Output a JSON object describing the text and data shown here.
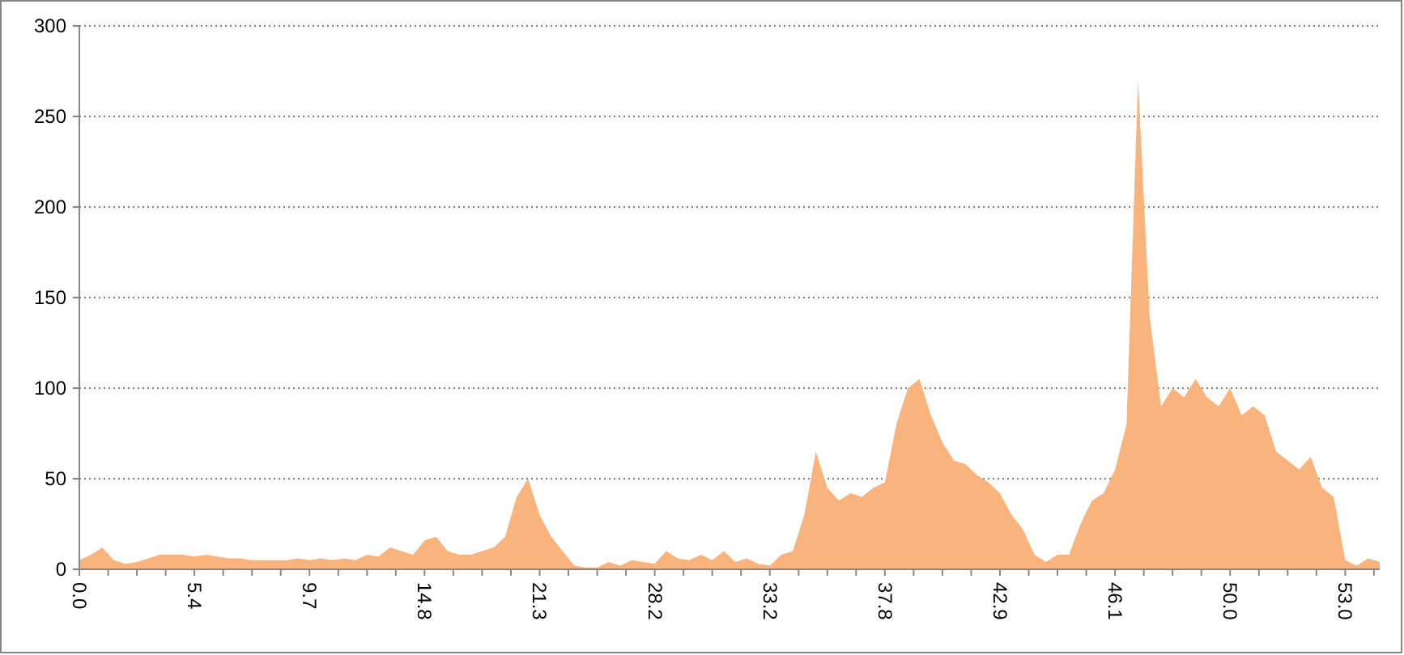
{
  "chart": {
    "chart_data": {
      "type": "area",
      "categories": [
        "0.0",
        null,
        null,
        null,
        null,
        null,
        null,
        null,
        null,
        null,
        "5.4",
        null,
        null,
        null,
        null,
        null,
        null,
        null,
        null,
        null,
        "9.7",
        null,
        null,
        null,
        null,
        null,
        null,
        null,
        null,
        null,
        "14.8",
        null,
        null,
        null,
        null,
        null,
        null,
        null,
        null,
        null,
        "21.3",
        null,
        null,
        null,
        null,
        null,
        null,
        null,
        null,
        null,
        "28.2",
        null,
        null,
        null,
        null,
        null,
        null,
        null,
        null,
        null,
        "33.2",
        null,
        null,
        null,
        null,
        null,
        null,
        null,
        null,
        null,
        "37.8",
        null,
        null,
        null,
        null,
        null,
        null,
        null,
        null,
        null,
        "42.9",
        null,
        null,
        null,
        null,
        null,
        null,
        null,
        null,
        null,
        "46.1",
        null,
        null,
        null,
        null,
        null,
        null,
        null,
        null,
        null,
        "50.0",
        null,
        null,
        null,
        null,
        null,
        null,
        null,
        null,
        null,
        "53.0",
        null,
        null,
        null
      ],
      "series": [
        {
          "color": "#f9b47d",
          "values": [
            5,
            8,
            12,
            5,
            3,
            4,
            6,
            8,
            8,
            8,
            7,
            8,
            7,
            6,
            6,
            5,
            5,
            5,
            5,
            6,
            5,
            6,
            5,
            6,
            5,
            8,
            7,
            12,
            10,
            8,
            16,
            18,
            10,
            8,
            8,
            10,
            12,
            18,
            40,
            50,
            30,
            18,
            10,
            2,
            1,
            1,
            4,
            2,
            5,
            4,
            3,
            10,
            6,
            5,
            8,
            5,
            10,
            4,
            6,
            3,
            2,
            8,
            10,
            30,
            65,
            45,
            38,
            42,
            40,
            45,
            48,
            80,
            100,
            105,
            85,
            70,
            60,
            58,
            52,
            48,
            42,
            30,
            22,
            8,
            4,
            8,
            8,
            25,
            38,
            42,
            55,
            80,
            270,
            140,
            90,
            100,
            95,
            105,
            95,
            90,
            100,
            85,
            90,
            85,
            65,
            60,
            55,
            62,
            45,
            40,
            5,
            2,
            6,
            4
          ]
        }
      ],
      "ylim": [
        0,
        300
      ],
      "grid": true,
      "yticks": [
        0,
        50,
        100,
        150,
        200,
        250,
        300
      ]
    }
  }
}
